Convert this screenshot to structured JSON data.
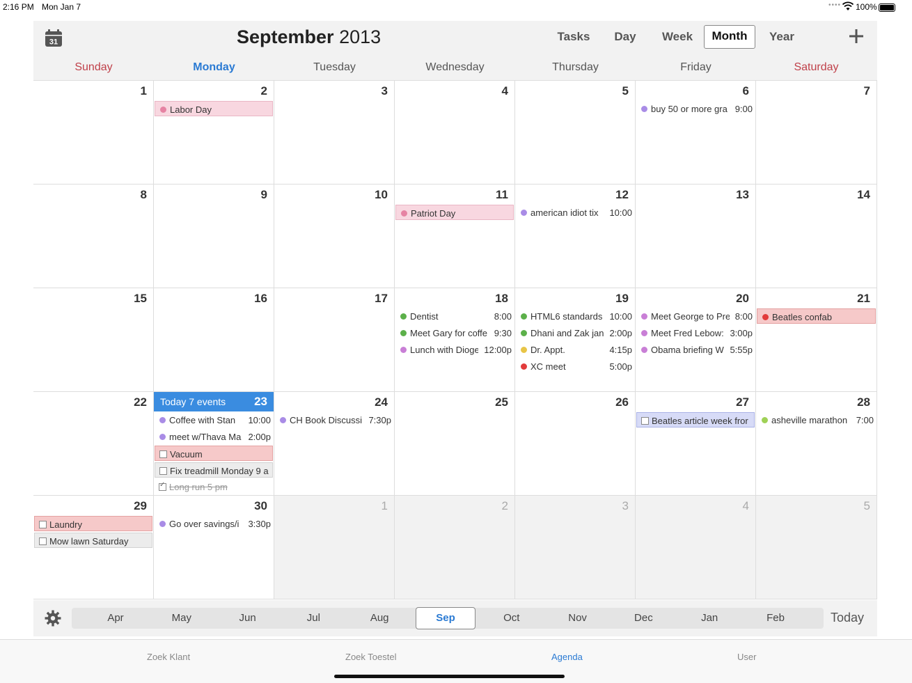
{
  "status": {
    "time": "2:16 PM",
    "date": "Mon Jan 7",
    "battery": "100%"
  },
  "header": {
    "title_month": "September",
    "title_year": "2013",
    "icon_day": "31",
    "views": [
      "Tasks",
      "Day",
      "Week",
      "Month",
      "Year"
    ],
    "active_view": "Month"
  },
  "weekdays": [
    "Sunday",
    "Monday",
    "Tuesday",
    "Wednesday",
    "Thursday",
    "Friday",
    "Saturday"
  ],
  "colors": {
    "accent": "#2a7ad3",
    "today_bar": "#3a8ce0",
    "weekend": "#c0414a",
    "purple": "#a98ce6",
    "green": "#5cb04a",
    "orchid": "#c97fd6",
    "yellow": "#e8c547",
    "red": "#e23b3b",
    "lime": "#9fd156",
    "pink": "#e683a3"
  },
  "weeks": [
    [
      {
        "n": "1"
      },
      {
        "n": "2",
        "events": [
          {
            "title": "Labor Day",
            "dot": "pink",
            "box": "pink"
          }
        ]
      },
      {
        "n": "3"
      },
      {
        "n": "4"
      },
      {
        "n": "5"
      },
      {
        "n": "6",
        "events": [
          {
            "title": "buy 50 or more gra",
            "time": "9:00",
            "dot": "purple"
          }
        ]
      },
      {
        "n": "7"
      }
    ],
    [
      {
        "n": "8"
      },
      {
        "n": "9"
      },
      {
        "n": "10"
      },
      {
        "n": "11",
        "events": [
          {
            "title": "Patriot Day",
            "dot": "pink",
            "box": "pink"
          }
        ]
      },
      {
        "n": "12",
        "events": [
          {
            "title": "american idiot tix",
            "time": "10:00",
            "dot": "purple"
          }
        ]
      },
      {
        "n": "13"
      },
      {
        "n": "14"
      }
    ],
    [
      {
        "n": "15"
      },
      {
        "n": "16"
      },
      {
        "n": "17"
      },
      {
        "n": "18",
        "events": [
          {
            "title": "Dentist",
            "time": "8:00",
            "dot": "green"
          },
          {
            "title": "Meet Gary for coffe",
            "time": "9:30",
            "dot": "green"
          },
          {
            "title": "Lunch with Dioge",
            "time": "12:00p",
            "dot": "orchid"
          }
        ]
      },
      {
        "n": "19",
        "events": [
          {
            "title": "HTML6 standards",
            "time": "10:00",
            "dot": "green"
          },
          {
            "title": "Dhani and Zak jan",
            "time": "2:00p",
            "dot": "green"
          },
          {
            "title": "Dr. Appt.",
            "time": "4:15p",
            "dot": "yellow"
          },
          {
            "title": "XC meet",
            "time": "5:00p",
            "dot": "red"
          }
        ]
      },
      {
        "n": "20",
        "events": [
          {
            "title": "Meet George to Pre",
            "time": "8:00",
            "dot": "orchid"
          },
          {
            "title": "Meet Fred Lebow:",
            "time": "3:00p",
            "dot": "orchid"
          },
          {
            "title": "Obama briefing W",
            "time": "5:55p",
            "dot": "orchid"
          }
        ]
      },
      {
        "n": "21",
        "events": [
          {
            "title": "Beatles confab",
            "dot": "red",
            "box": "red"
          }
        ]
      }
    ],
    [
      {
        "n": "22"
      },
      {
        "n": "23",
        "today": true,
        "today_label": "Today 7 events",
        "events": [
          {
            "title": "Coffee with Stan",
            "time": "10:00",
            "dot": "purple"
          },
          {
            "title": "meet w/Thava Ma",
            "time": "2:00p",
            "dot": "purple"
          },
          {
            "title": "Vacuum",
            "task": true,
            "box": "red"
          },
          {
            "title": "Fix treadmill Monday 9 a",
            "task": true,
            "box": "gray"
          },
          {
            "title": "Long run 5 pm",
            "task": true,
            "done": true
          }
        ]
      },
      {
        "n": "24",
        "events": [
          {
            "title": "CH Book Discussi",
            "time": "7:30p",
            "dot": "purple"
          }
        ]
      },
      {
        "n": "25"
      },
      {
        "n": "26"
      },
      {
        "n": "27",
        "events": [
          {
            "title": "Beatles article week fror",
            "task": true,
            "box": "blue"
          }
        ]
      },
      {
        "n": "28",
        "events": [
          {
            "title": "asheville marathon",
            "time": "7:00",
            "dot": "lime"
          }
        ]
      }
    ],
    [
      {
        "n": "29",
        "events": [
          {
            "title": "Laundry",
            "task": true,
            "box": "red"
          },
          {
            "title": "Mow lawn Saturday",
            "task": true,
            "box": "gray"
          }
        ]
      },
      {
        "n": "30",
        "events": [
          {
            "title": "Go over savings/i",
            "time": "3:30p",
            "dot": "purple"
          }
        ]
      },
      {
        "n": "1",
        "other": true
      },
      {
        "n": "2",
        "other": true
      },
      {
        "n": "3",
        "other": true
      },
      {
        "n": "4",
        "other": true
      },
      {
        "n": "5",
        "other": true
      }
    ]
  ],
  "months": [
    "Apr",
    "May",
    "Jun",
    "Jul",
    "Aug",
    "Sep",
    "Oct",
    "Nov",
    "Dec",
    "Jan",
    "Feb"
  ],
  "active_month": "Sep",
  "today_button": "Today",
  "tabs": [
    "Zoek Klant",
    "Zoek Toestel",
    "Agenda",
    "User"
  ],
  "active_tab": "Agenda"
}
